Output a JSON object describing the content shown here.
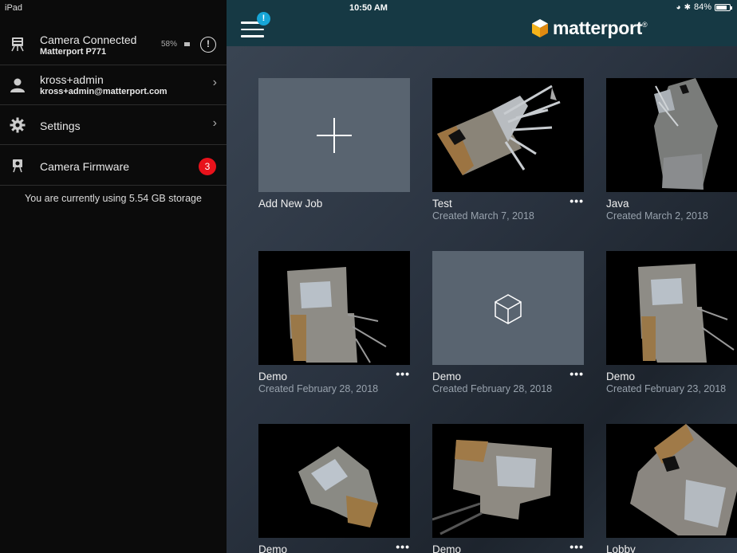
{
  "status_bar": {
    "device": "iPad",
    "time": "10:50 AM",
    "battery": "84%",
    "battery_level": 0.84
  },
  "sidebar": {
    "camera": {
      "title": "Camera Connected",
      "model": "Matterport P771",
      "battery": "58%"
    },
    "account": {
      "name": "kross+admin",
      "email": "kross+admin@matterport.com"
    },
    "settings": {
      "label": "Settings"
    },
    "firmware": {
      "label": "Camera Firmware",
      "badge": "3"
    },
    "storage_text": "You are currently using 5.54 GB storage"
  },
  "header": {
    "brand": "matterport",
    "trademark": "®",
    "notification": "!"
  },
  "jobs": [
    {
      "title": "Add New Job",
      "date": "",
      "kind": "add"
    },
    {
      "title": "Test",
      "date": "Created March 7, 2018",
      "kind": "scan"
    },
    {
      "title": "Java",
      "date": "Created March 2, 2018",
      "kind": "scan"
    },
    {
      "title": "Demo",
      "date": "Created February 28, 2018",
      "kind": "scan"
    },
    {
      "title": "Demo",
      "date": "Created February 28, 2018",
      "kind": "empty"
    },
    {
      "title": "Demo",
      "date": "Created February 23, 2018",
      "kind": "scan"
    },
    {
      "title": "Demo",
      "date": "",
      "kind": "scan"
    },
    {
      "title": "Demo",
      "date": "",
      "kind": "scan"
    },
    {
      "title": "Lobby",
      "date": "",
      "kind": "scan"
    }
  ],
  "more_label": "•••",
  "colors": {
    "topbar": "#163944",
    "accent": "#17a5d6",
    "badge": "#e8121b"
  }
}
